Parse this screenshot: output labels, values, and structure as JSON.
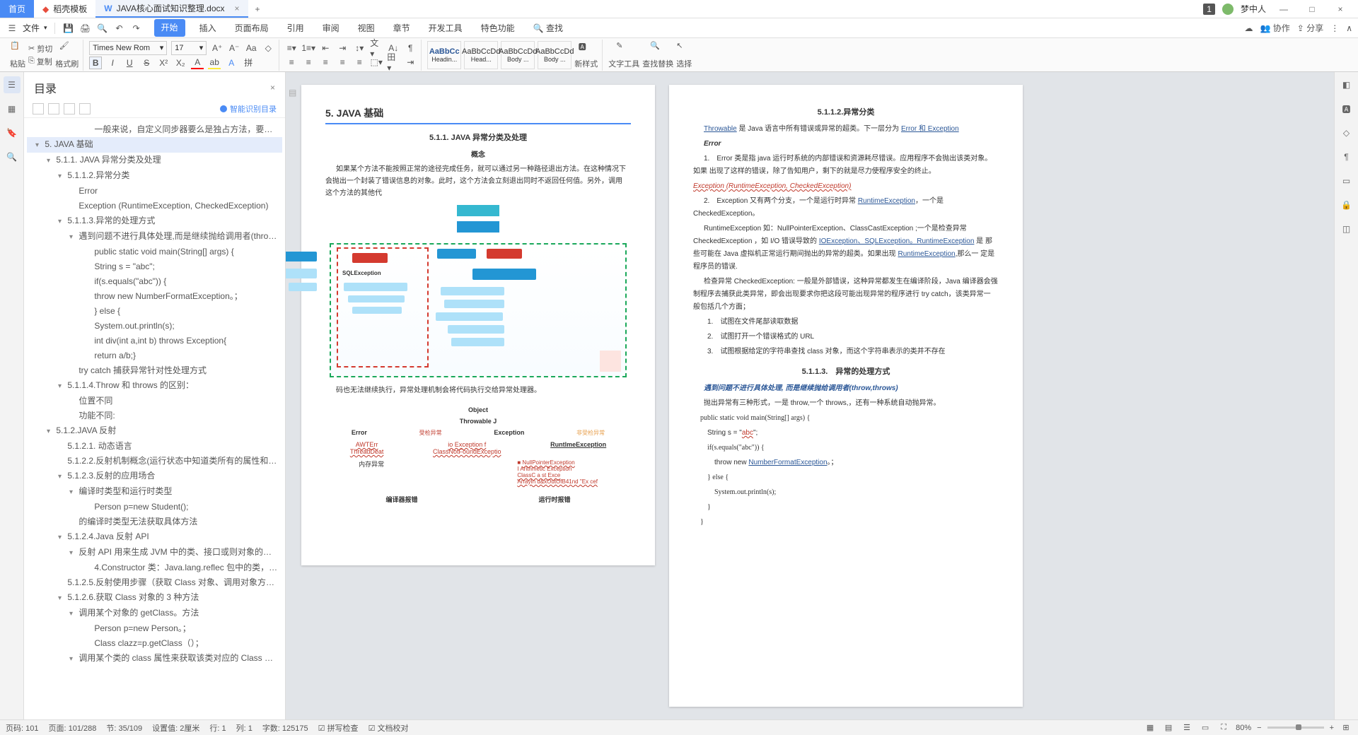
{
  "tabs": {
    "home": "首页",
    "template": "稻壳模板",
    "doc": "JAVA核心面试知识整理.docx"
  },
  "user": {
    "badge": "1",
    "name": "梦中人"
  },
  "menu": {
    "file": "文件"
  },
  "ribbonTabs": [
    "开始",
    "插入",
    "页面布局",
    "引用",
    "审阅",
    "视图",
    "章节",
    "开发工具",
    "特色功能"
  ],
  "search": {
    "label": "查找"
  },
  "menuRight": {
    "coop": "协作",
    "share": "分享"
  },
  "clipboard": {
    "paste": "粘贴",
    "cut": "剪切",
    "copy": "复制",
    "format": "格式刷"
  },
  "font": {
    "name": "Times New Rom",
    "size": "17"
  },
  "styles": [
    {
      "preview": "AaBbCc",
      "name": "Headin..."
    },
    {
      "preview": "AaBbCcDd",
      "name": "Head..."
    },
    {
      "preview": "AaBbCcDd",
      "name": "Body ..."
    },
    {
      "preview": "AaBbCcDd",
      "name": "Body ..."
    }
  ],
  "ribbonBtns": {
    "newstyle": "新样式",
    "texttools": "文字工具",
    "findreplace": "查找替换",
    "select": "选择"
  },
  "toc": {
    "title": "目录",
    "smart": "智能识别目录",
    "items": [
      {
        "lvl": 5,
        "arrow": "",
        "text": "一般来说，自定义同步器要么是独占方法，要么是共享方 ..."
      },
      {
        "lvl": 1,
        "arrow": "▾",
        "text": "5. JAVA 基础",
        "sel": true
      },
      {
        "lvl": 2,
        "arrow": "▾",
        "text": "5.1.1. JAVA 异常分类及处理"
      },
      {
        "lvl": 3,
        "arrow": "▾",
        "text": "5.1.1.2.异常分类"
      },
      {
        "lvl": 4,
        "arrow": "",
        "text": "Error"
      },
      {
        "lvl": 4,
        "arrow": "",
        "text": "Exception (RuntimeException, CheckedException)"
      },
      {
        "lvl": 3,
        "arrow": "▾",
        "text": "5.1.1.3.异常的处理方式"
      },
      {
        "lvl": 4,
        "arrow": "▾",
        "text": "遇到问题不进行具体处理,而是继续抛给调用者(throw,throws)"
      },
      {
        "lvl": 5,
        "arrow": "",
        "text": "public static void main(String[] args) {"
      },
      {
        "lvl": 5,
        "arrow": "",
        "text": "String s = \"abc\";"
      },
      {
        "lvl": 5,
        "arrow": "",
        "text": "if(s.equals(\"abc\")) {"
      },
      {
        "lvl": 5,
        "arrow": "",
        "text": "throw new NumberFormatException。；"
      },
      {
        "lvl": 5,
        "arrow": "",
        "text": "} else {"
      },
      {
        "lvl": 5,
        "arrow": "",
        "text": "System.out.println(s);"
      },
      {
        "lvl": 5,
        "arrow": "",
        "text": "int div(int a,int b) throws Exception{"
      },
      {
        "lvl": 5,
        "arrow": "",
        "text": "return a/b;}"
      },
      {
        "lvl": 4,
        "arrow": "",
        "text": "try catch 捕获异常针对性处理方式"
      },
      {
        "lvl": 3,
        "arrow": "▾",
        "text": "5.1.1.4.Throw 和 throws 的区别："
      },
      {
        "lvl": 4,
        "arrow": "",
        "text": "位置不同"
      },
      {
        "lvl": 4,
        "arrow": "",
        "text": "功能不同:"
      },
      {
        "lvl": 2,
        "arrow": "▾",
        "text": "5.1.2.JAVA 反射"
      },
      {
        "lvl": 3,
        "arrow": "",
        "text": "5.1.2.1. 动态语言"
      },
      {
        "lvl": 3,
        "arrow": "",
        "text": "5.1.2.2.反射机制概念(运行状态中知道类所有的属性和方法)"
      },
      {
        "lvl": 3,
        "arrow": "▾",
        "text": "5.1.2.3.反射的应用场合"
      },
      {
        "lvl": 4,
        "arrow": "▾",
        "text": "编译时类型和运行时类型"
      },
      {
        "lvl": 5,
        "arrow": "",
        "text": "Person p=new Student();"
      },
      {
        "lvl": 4,
        "arrow": "",
        "text": "的编译时类型无法获取具体方法"
      },
      {
        "lvl": 3,
        "arrow": "▾",
        "text": "5.1.2.4.Java 反射 API"
      },
      {
        "lvl": 4,
        "arrow": "▾",
        "text": "反射 API 用来生成 JVM 中的类、接口或则对象的信息。"
      },
      {
        "lvl": 5,
        "arrow": "",
        "text": "4.Constructor 类：Java.lang.reflec 包中的类，表示类的..."
      },
      {
        "lvl": 3,
        "arrow": "",
        "text": "5.1.2.5.反射使用步骤（获取 Class 对象、调用对象方法）"
      },
      {
        "lvl": 3,
        "arrow": "▾",
        "text": "5.1.2.6.获取 Class 对象的 3 种方法"
      },
      {
        "lvl": 4,
        "arrow": "▾",
        "text": "调用某个对象的 getClass。方法"
      },
      {
        "lvl": 5,
        "arrow": "",
        "text": "Person p=new Person。；"
      },
      {
        "lvl": 5,
        "arrow": "",
        "text": "Class clazz=p.getClass（）；"
      },
      {
        "lvl": 4,
        "arrow": "▾",
        "text": "调用某个类的 class 属性来获取该类对应的 Class 对象"
      }
    ]
  },
  "page1": {
    "h2": "5. JAVA 基础",
    "h3": "5.1.1. JAVA 异常分类及处理",
    "h4a": "概念",
    "p1": "如果某个方法不能按照正常的途径完成任务，就可以通过另一种路径退出方法。在这种情况下 会抛出一个封装了错误信息的对象。此时，这个方法会立刻退出同时不返回任何值。另外，调用 这个方法的其他代",
    "sql": "SQLException",
    "p2": "码也无法继续执行，异常处理机制会将代码执行交给异常处理器。",
    "obj": "Object",
    "throwj": "Throwable J",
    "error": "Error",
    "exception": "Exception",
    "rte": "RuntlmeException",
    "awt": "AWTErr",
    "td": "ThreadDeat",
    "ioe": "io Exception f",
    "cnfe": "ClassNotFoundExceptio",
    "receive": "受检异常",
    "nreceive": "非受检异常",
    "npe": "NullPointerException",
    "ae": "Arithmetic Exception",
    "cce": "ClassC a st Exce",
    "aie": "ArrayIn d&xOutOfB41nd \"Ex cef",
    "mem": "内存异常",
    "compile": "编译器报错",
    "runtime": "运行时报错"
  },
  "page2": {
    "title": "5.1.1.2.异常分类",
    "p1a": "Throwable",
    "p1b": " 是 Java 语言中所有错误或异常的超类。下一层分为 ",
    "p1c": "Error 和 Exception",
    "error_h": "Error",
    "p2": "1.　Error 类是指 java 运行时系统的内部错误和资源耗尽错误。应用程序不会抛出该类对象。如果 出现了这样的错误，除了告知用户，剩下的就是尽力使程序安全的终止。",
    "p3": "Exception (RuntimeException, CheckedException)",
    "p4a": "2.　Exception 又有两个分支，一个是运行时异常 ",
    "p4b": "RuntimeException",
    "p4c": "，一个是 CheckedException。",
    "p5a": "RuntimeException 如：NullPointerException、ClassCastException ;一个是检查异常 CheckedException ，如 I/O 错误导致的 ",
    "p5b": "IOException、SQLException。RuntimeException",
    "p5c": " 是 那些可能在 Java 虚拟机正常运行期间抛出的异常的超类。如果出现 ",
    "p5d": "RuntimeException",
    "p5e": ",那么一 定是程序员的错误.",
    "p6": "检查异常 CheckedException: 一般是外部错误，这种异常都发生在编译阶段，Java 编译器会强 制程序去捕获此类异常，即会出现要求你把这段可能出现异常的程序进行 try catch，该类异常一 般包括几个方面；",
    "li1": "1.　试图在文件尾部读取数据",
    "li2": "2.　试图打开一个错误格式的 URL",
    "li3": "3.　试图根据给定的字符串查找 class 对象，而这个字符串表示的类并不存在",
    "h513": "5.1.1.3.　异常的处理方式",
    "p7": "遇到问题不进行具体处理, 而是继续抛给调用者(throw,throws)",
    "p8": "抛出异常有三种形式，一是 throw,一个 throws,，还有一种系统自动抛异常。",
    "c1": "public static void main(String[] args) {",
    "c2": "String s = \"abc\";",
    "c3": "if(s.equals(\"abc\")) {",
    "c4": "throw new NumberFormatException。；",
    "c5": "} else {",
    "c6": "System.out.println(s);",
    "c7": "}",
    "c8": "}"
  },
  "status": {
    "page": "页码: 101",
    "pages": "页面: 101/288",
    "section": "节: 35/109",
    "set": "设置值: 2厘米",
    "line": "行: 1",
    "col": "列: 1",
    "words": "字数: 125175",
    "spell": "拼写检查",
    "doccheck": "文档校对",
    "zoom": "80%"
  }
}
